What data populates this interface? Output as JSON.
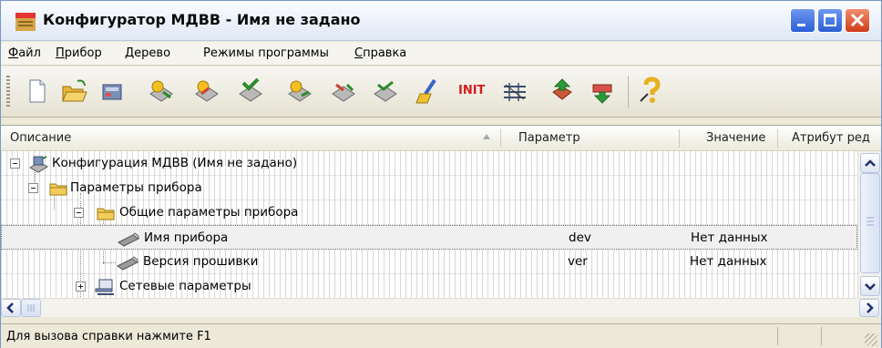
{
  "window": {
    "title": "Конфигуратор МДВВ - Имя не задано"
  },
  "menu": {
    "items": [
      {
        "ul": "Ф",
        "rest": "айл"
      },
      {
        "ul": "П",
        "rest": "рибор"
      },
      {
        "ul": "Д",
        "rest": "ерево"
      },
      {
        "ul": "",
        "rest": "Режимы программы"
      },
      {
        "ul": "С",
        "rest": "правка"
      }
    ]
  },
  "toolbar": {
    "init_label": "INIT"
  },
  "columns": {
    "description": "Описание",
    "parameter": "Параметр",
    "value": "Значение",
    "attribute": "Атрибут ред"
  },
  "tree": {
    "rows": [
      {
        "label": "Конфигурация МДВВ (Имя не задано)",
        "param": "",
        "value": ""
      },
      {
        "label": "Параметры прибора",
        "param": "",
        "value": ""
      },
      {
        "label": "Общие параметры прибора",
        "param": "",
        "value": ""
      },
      {
        "label": "Имя прибора",
        "param": "dev",
        "value": "Нет данных"
      },
      {
        "label": "Версия прошивки",
        "param": "ver",
        "value": "Нет данных"
      },
      {
        "label": "Сетевые параметры",
        "param": "",
        "value": ""
      }
    ]
  },
  "status": {
    "text": "Для вызова справки нажмите F1"
  },
  "colors": {
    "selection": "#f0f0f0",
    "titlebar": "#eef3fb",
    "close_button": "#cf3b1a",
    "window_buttons": "#2b5fd6"
  }
}
